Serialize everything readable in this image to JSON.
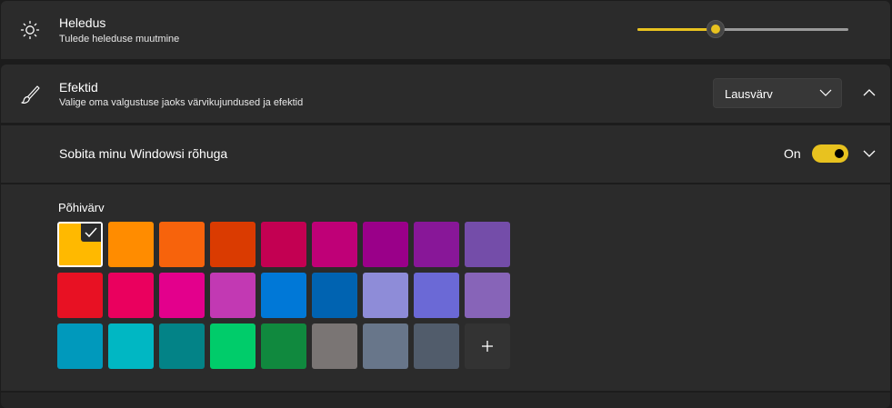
{
  "brightness": {
    "title": "Heledus",
    "description": "Tulede heleduse muutmine",
    "icon": "brightness-icon",
    "level": 0.37,
    "accent": "#e8c21f"
  },
  "effects": {
    "title": "Efektid",
    "description": "Valige oma valgustuse jaoks värvikujundused ja efektid",
    "icon": "brush-icon",
    "dropdown_value": "Lausvärv"
  },
  "accent_match": {
    "title": "Sobita minu Windowsi rõhuga",
    "toggle_label": "On",
    "toggle_on": true
  },
  "color_picker": {
    "label": "Põhivärv",
    "selected_index": 0,
    "colors": [
      "#ffb900",
      "#ff8c00",
      "#f7630c",
      "#da3b01",
      "#c30052",
      "#bf0077",
      "#9a0089",
      "#881798",
      "#744da9",
      "#e81123",
      "#ea005e",
      "#e3008c",
      "#c239b3",
      "#0078d7",
      "#0063b1",
      "#8e8cd8",
      "#6b69d6",
      "#8764b8",
      "#0099bc",
      "#00b7c3",
      "#038387",
      "#00cc6a",
      "#10893e",
      "#7a7574",
      "#68768a",
      "#515c6b"
    ],
    "add_icon": "plus-icon"
  }
}
